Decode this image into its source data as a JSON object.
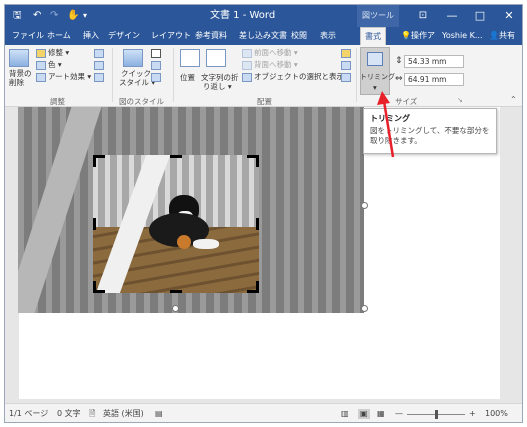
{
  "titlebar": {
    "title": "文書 1 - Word",
    "context_label": "図ツール",
    "minimize": "—",
    "maximize": "□",
    "close": "✕",
    "ribbon_display": "⊡"
  },
  "quick_access": {
    "save": "🖫",
    "undo": "↶",
    "redo": "↷",
    "customize": "▾"
  },
  "tabs": [
    "ファイル",
    "ホーム",
    "挿入",
    "デザイン",
    "レイアウト",
    "参考資料",
    "差し込み文書",
    "校閲",
    "表示",
    "書式"
  ],
  "tab_search": "操作ア",
  "user": "Yoshie K...",
  "share": "共有",
  "ribbon": {
    "adjust": {
      "remove_bg": [
        "背景の",
        "削除"
      ],
      "corrections": "修整 ▾",
      "color": "色 ▾",
      "artistic": "アート効果 ▾",
      "label": "調整"
    },
    "picture_styles": {
      "quick_styles": [
        "クイック",
        "スタイル ▾"
      ],
      "label": "図のスタイル"
    },
    "arrange": {
      "position": "位置",
      "wrap": [
        "文字列の折",
        "り返し ▾"
      ],
      "bring_forward": "前面へ移動 ▾",
      "send_backward": "背面へ移動 ▾",
      "selection_pane": "オブジェクトの選択と表示",
      "label": "配置"
    },
    "size": {
      "crop": "トリミング",
      "height": "54.33 mm",
      "width": "64.91 mm",
      "label": "サイズ"
    }
  },
  "tooltip": {
    "title": "トリミング",
    "body": "図をトリミングして、不要な部分を取り除きます。"
  },
  "statusbar": {
    "page": "1/1 ページ",
    "words": "0 文字",
    "language": "英語 (米国)",
    "zoom": "100%",
    "zoom_minus": "—",
    "zoom_plus": "+"
  },
  "colors": {
    "word_blue": "#2b579a",
    "arrow_red": "#e8202a"
  }
}
